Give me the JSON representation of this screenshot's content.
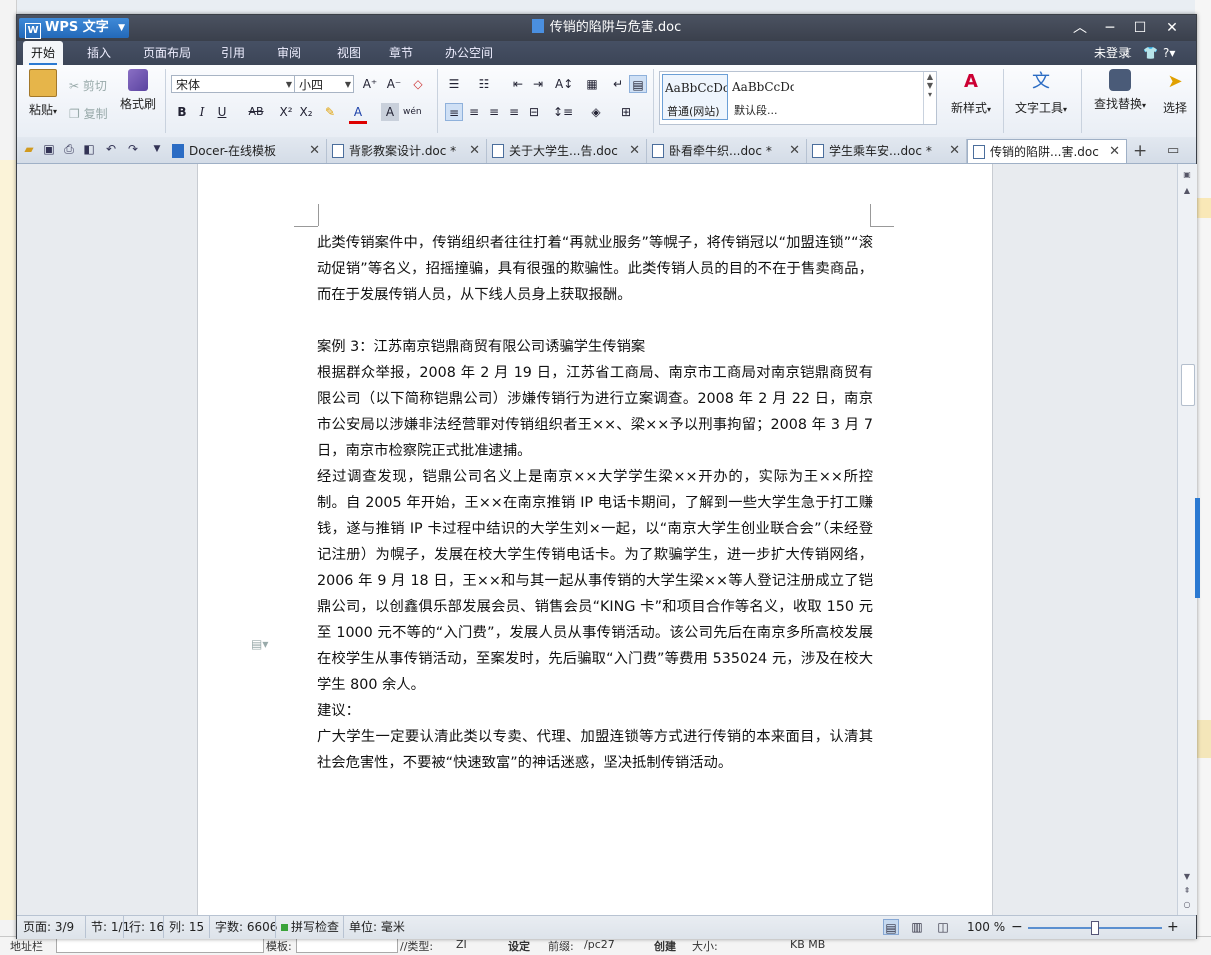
{
  "app": {
    "brand": "WPS 文字",
    "window_title": "传销的陷阱与危害.doc",
    "login": "未登录"
  },
  "menu": [
    "开始",
    "插入",
    "页面布局",
    "引用",
    "审阅",
    "视图",
    "章节",
    "办公空间"
  ],
  "ribbon": {
    "paste": "粘贴",
    "cut": "剪切",
    "copy": "复制",
    "format_painter": "格式刷",
    "font_name": "宋体",
    "font_size": "小四",
    "styles": [
      {
        "sample": "AaBbCcDc",
        "name": "普通(网站)"
      },
      {
        "sample": "AaBbCcDd",
        "name": "默认段..."
      }
    ],
    "new_style": "新样式",
    "text_tools": "文字工具",
    "find_replace": "查找替换",
    "select": "选择"
  },
  "tabs": [
    {
      "label": "Docer-在线模板",
      "active": false
    },
    {
      "label": "背影教案设计.doc *",
      "active": false
    },
    {
      "label": "关于大学生...告.doc",
      "active": false
    },
    {
      "label": "卧看牵牛织...doc *",
      "active": false
    },
    {
      "label": "学生乘车安...doc *",
      "active": false
    },
    {
      "label": "传销的陷阱...害.doc",
      "active": true
    }
  ],
  "document": {
    "paragraphs": [
      "此类传销案件中，传销组织者往往打着“再就业服务”等幌子，将传销冠以“加盟连锁”“滚动促销”等名义，招摇撞骗，具有很强的欺骗性。此类传销人员的目的不在于售卖商品，而在于发展传销人员，从下线人员身上获取报酬。",
      "",
      "案例 3：江苏南京铠鼎商贸有限公司诱骗学生传销案",
      "根据群众举报，2008 年 2 月 19 日，江苏省工商局、南京市工商局对南京铠鼎商贸有限公司（以下简称铠鼎公司）涉嫌传销行为进行立案调查。2008 年 2 月 22 日，南京市公安局以涉嫌非法经营罪对传销组织者王××、梁××予以刑事拘留；2008 年 3 月 7 日，南京市检察院正式批准逮捕。",
      "经过调查发现，铠鼎公司名义上是南京××大学学生梁××开办的，实际为王××所控制。自 2005 年开始，王××在南京推销 IP 电话卡期间，了解到一些大学生急于打工赚钱，遂与推销 IP 卡过程中结识的大学生刘×一起，以“南京大学生创业联合会”（未经登记注册）为幌子，发展在校大学生传销电话卡。为了欺骗学生，进一步扩大传销网络，2006 年 9 月 18 日，王××和与其一起从事传销的大学生梁××等人登记注册成立了铠鼎公司，以创鑫俱乐部发展会员、销售会员“KING 卡”和项目合作等名义，收取 150 元至 1000 元不等的“入门费”，发展人员从事传销活动。该公司先后在南京多所高校发展在校学生从事传销活动，至案发时，先后骗取“入门费”等费用 535024 元，涉及在校大学生 800 余人。",
      "建议：",
      "广大学生一定要认清此类以专卖、代理、加盟连锁等方式进行传销的本来面目，认清其社会危害性，不要被“快速致富”的神话迷惑，坚决抵制传销活动。"
    ]
  },
  "status": {
    "page": "页面: 3/9",
    "section": "节: 1/1",
    "row": "行: 16",
    "col": "列: 15",
    "words": "字数: 6606",
    "spell": "拼写检查",
    "unit": "单位: 毫米",
    "zoom": "100 %"
  },
  "background": {
    "bottom_left": "地址栏",
    "bottom_mid1": "模板:",
    "bottom_mid2": "//类型:",
    "bottom_val": "ZI",
    "bottom_btn": "设定",
    "bottom_lbl": "前缀:",
    "bottom_val2": "/pc27",
    "bottom_btn2": "创建",
    "bottom_lbl2": "大小:",
    "bottom_radio": "KB   MB"
  }
}
